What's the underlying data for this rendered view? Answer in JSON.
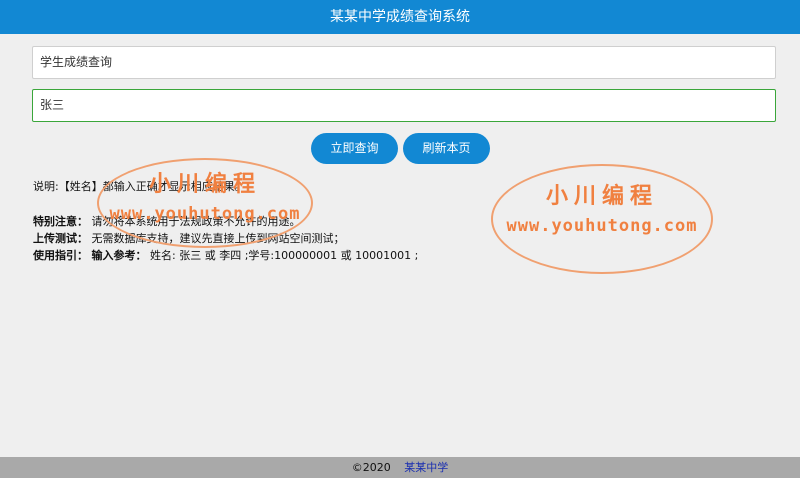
{
  "header": {
    "title": "某某中学成绩查询系统"
  },
  "form": {
    "query_type_value": "学生成绩查询",
    "name_value": "张三"
  },
  "buttons": {
    "query_label": "立即查询",
    "refresh_label": "刷新本页"
  },
  "notes": {
    "line1": "说明:【姓名】都输入正确才显示相应结果。",
    "line2_label": "特别注意：",
    "line2_text": "请勿将本系统用于法规政策不允许的用途。",
    "line3_label": "上传测试：",
    "line3_text": "无需数据库支持，建议先直接上传到网站空间测试；",
    "line4_label": "使用指引：",
    "line4_label2": "输入参考：",
    "line4_text": "姓名: 张三 或 李四 ;学号:100000001 或 10001001 ;"
  },
  "watermark": {
    "cn": "小川编程",
    "url": "www.youhutong.com"
  },
  "footer": {
    "copyright": "©2020",
    "link": "某某中学"
  },
  "colors": {
    "accent": "#1288d3",
    "watermark": "#f08040",
    "footer_bg": "#a9a9a9"
  }
}
